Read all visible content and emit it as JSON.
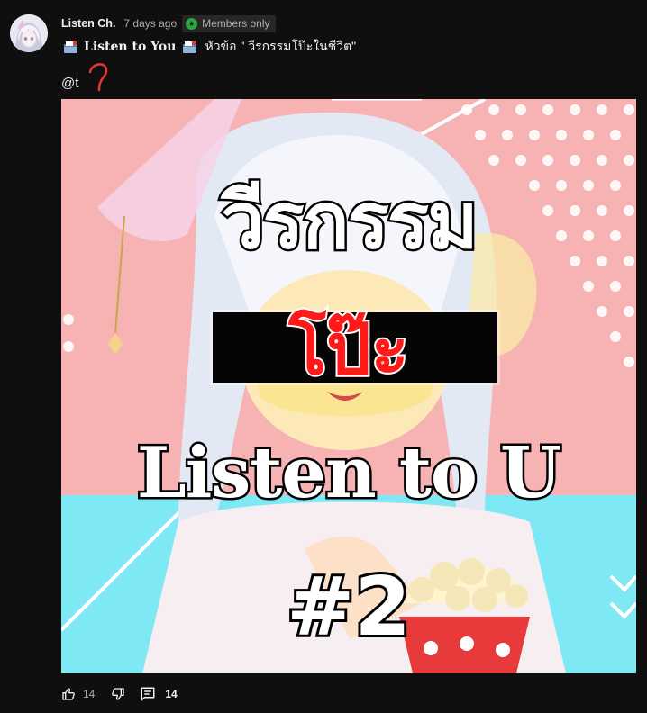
{
  "post": {
    "author": "Listen Ch.",
    "time": "7 days ago",
    "members_badge": "Members only",
    "title_name": "Listen to You",
    "title_topic": "หัวข้อ \" วีรกรรมโป๊ะในชีวิต\"",
    "mention": "@t"
  },
  "image": {
    "line1": "วีรกรรม",
    "line2": "โป๊ะ",
    "line3": "Listen to U",
    "line4": "#2"
  },
  "actions": {
    "like_count": "14",
    "comment_count": "14"
  },
  "icons": {
    "members": "members-star-icon",
    "mail": "mailbox-icon",
    "like": "thumbs-up-icon",
    "dislike": "thumbs-down-icon",
    "comment": "comment-icon"
  },
  "colors": {
    "background": "#0f0f0f",
    "badge_green": "#2ba640",
    "secondary_text": "#aaaaaa",
    "primary_text": "#f1f1f1",
    "image_pink": "#f7b3b3",
    "image_cyan": "#7fe8f5",
    "highlight_red": "#ff1a1a"
  }
}
